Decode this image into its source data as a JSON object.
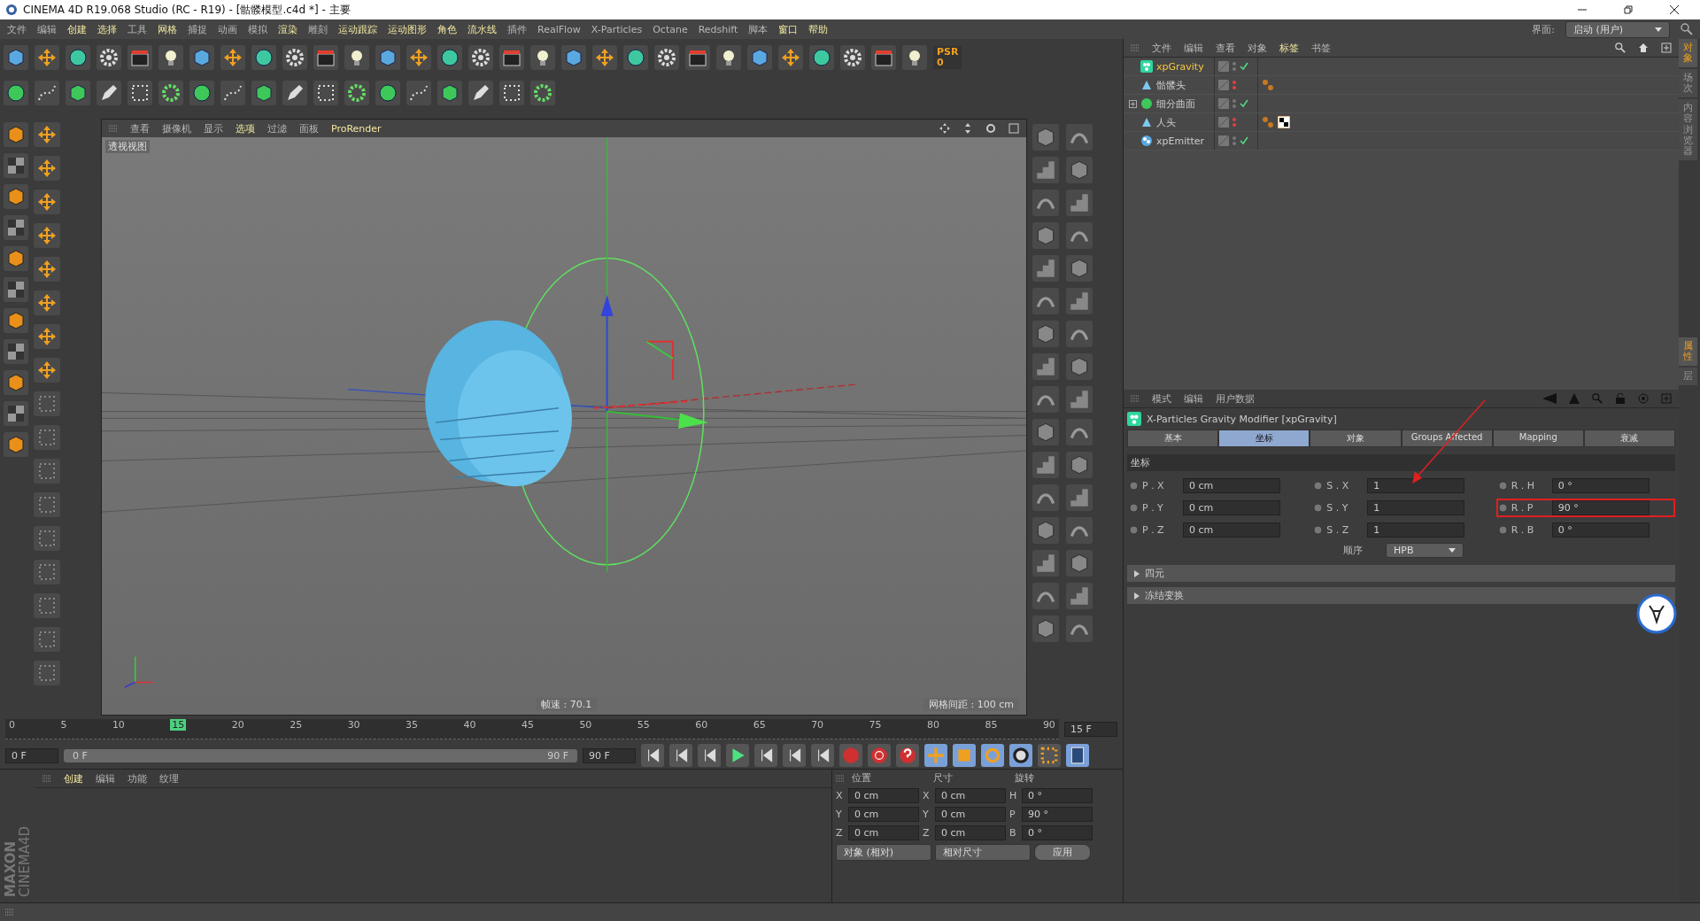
{
  "window": {
    "title": "CINEMA 4D R19.068 Studio (RC - R19) - [骷髅模型.c4d *] - 主要"
  },
  "menu": [
    {
      "label": "文件",
      "highlight": false
    },
    {
      "label": "编辑",
      "highlight": false
    },
    {
      "label": "创建",
      "highlight": true
    },
    {
      "label": "选择",
      "highlight": true
    },
    {
      "label": "工具",
      "highlight": false
    },
    {
      "label": "网格",
      "highlight": true
    },
    {
      "label": "捕捉",
      "highlight": false
    },
    {
      "label": "动画",
      "highlight": false
    },
    {
      "label": "模拟",
      "highlight": false
    },
    {
      "label": "渲染",
      "highlight": true
    },
    {
      "label": "雕刻",
      "highlight": false
    },
    {
      "label": "运动跟踪",
      "highlight": true
    },
    {
      "label": "运动图形",
      "highlight": true
    },
    {
      "label": "角色",
      "highlight": true
    },
    {
      "label": "流水线",
      "highlight": true
    },
    {
      "label": "插件",
      "highlight": false
    },
    {
      "label": "RealFlow",
      "highlight": false
    },
    {
      "label": "X-Particles",
      "highlight": false
    },
    {
      "label": "Octane",
      "highlight": false
    },
    {
      "label": "Redshift",
      "highlight": false
    },
    {
      "label": "脚本",
      "highlight": false
    },
    {
      "label": "窗口",
      "highlight": true
    },
    {
      "label": "帮助",
      "highlight": true
    }
  ],
  "layout_picker": {
    "label": "界面:",
    "value": "启动 (用户)"
  },
  "psr": {
    "label": "PSR",
    "value": "0"
  },
  "viewport": {
    "menu": [
      {
        "label": "查看",
        "highlight": false
      },
      {
        "label": "摄像机",
        "highlight": false
      },
      {
        "label": "显示",
        "highlight": false
      },
      {
        "label": "选项",
        "highlight": true
      },
      {
        "label": "过滤",
        "highlight": false
      },
      {
        "label": "面板",
        "highlight": false
      },
      {
        "label": "ProRender",
        "highlight": true
      }
    ],
    "camera_label": "透视视图",
    "fps": "帧速 : 70.1",
    "grid_spacing": "网格间距 : 100 cm"
  },
  "object_manager": {
    "menu": [
      {
        "label": "文件",
        "highlight": false
      },
      {
        "label": "编辑",
        "highlight": false
      },
      {
        "label": "查看",
        "highlight": false
      },
      {
        "label": "对象",
        "highlight": false
      },
      {
        "label": "标签",
        "highlight": true
      },
      {
        "label": "书签",
        "highlight": false
      }
    ],
    "objects": [
      {
        "name": "xpGravity",
        "kind": "modifier",
        "selected": true,
        "expandable": false,
        "checked": true
      },
      {
        "name": "骷髅头",
        "kind": "polygon",
        "selected": false,
        "expandable": false,
        "checked": false,
        "tags": [
          {
            "kind": "material"
          }
        ]
      },
      {
        "name": "细分曲面",
        "kind": "subdivision",
        "selected": false,
        "expandable": true,
        "checked": true
      },
      {
        "name": "人头",
        "kind": "polygon",
        "selected": false,
        "expandable": false,
        "checked": false,
        "tags": [
          {
            "kind": "material"
          },
          {
            "kind": "texture"
          }
        ]
      },
      {
        "name": "xpEmitter",
        "kind": "emitter",
        "selected": false,
        "expandable": false,
        "checked": true
      }
    ]
  },
  "attributes": {
    "menu": [
      {
        "label": "模式",
        "highlight": false
      },
      {
        "label": "编辑",
        "highlight": false
      },
      {
        "label": "用户数据",
        "highlight": false
      }
    ],
    "title": "X-Particles Gravity Modifier [xpGravity]",
    "tabs": [
      {
        "label": "基本",
        "selected": false
      },
      {
        "label": "坐标",
        "selected": true
      },
      {
        "label": "对象",
        "selected": false
      },
      {
        "label": "Groups Affected",
        "selected": false
      },
      {
        "label": "Mapping",
        "selected": false
      },
      {
        "label": "衰减",
        "selected": false
      }
    ],
    "section": "坐标",
    "rows": [
      [
        {
          "label": "P . X",
          "value": "0 cm",
          "highlighted": false
        },
        {
          "label": "S . X",
          "value": "1",
          "highlighted": false
        },
        {
          "label": "R . H",
          "value": "0 °",
          "highlighted": false
        }
      ],
      [
        {
          "label": "P . Y",
          "value": "0 cm",
          "highlighted": false
        },
        {
          "label": "S . Y",
          "value": "1",
          "highlighted": false
        },
        {
          "label": "R . P",
          "value": "90 °",
          "highlighted": true
        }
      ],
      [
        {
          "label": "P . Z",
          "value": "0 cm",
          "highlighted": false
        },
        {
          "label": "S . Z",
          "value": "1",
          "highlighted": false
        },
        {
          "label": "R . B",
          "value": "0 °",
          "highlighted": false
        }
      ]
    ],
    "order": {
      "label": "顺序",
      "value": "HPB"
    },
    "groups": [
      {
        "label": "四元",
        "expanded": false
      },
      {
        "label": "冻结变换",
        "expanded": false
      }
    ]
  },
  "side_tabs_top": [
    {
      "label": "对象",
      "selected": true
    },
    {
      "label": "场次",
      "selected": false
    },
    {
      "label": "内容浏览器",
      "selected": false
    }
  ],
  "side_tabs_bottom": [
    {
      "label": "属性",
      "selected": true
    },
    {
      "label": "层",
      "selected": false
    }
  ],
  "timeline": {
    "ticks": [
      {
        "label": "0",
        "selected": false
      },
      {
        "label": "5",
        "selected": false
      },
      {
        "label": "10",
        "selected": false
      },
      {
        "label": "15",
        "selected": true
      },
      {
        "label": "20",
        "selected": false
      },
      {
        "label": "25",
        "selected": false
      },
      {
        "label": "30",
        "selected": false
      },
      {
        "label": "35",
        "selected": false
      },
      {
        "label": "40",
        "selected": false
      },
      {
        "label": "45",
        "selected": false
      },
      {
        "label": "50",
        "selected": false
      },
      {
        "label": "55",
        "selected": false
      },
      {
        "label": "60",
        "selected": false
      },
      {
        "label": "65",
        "selected": false
      },
      {
        "label": "70",
        "selected": false
      },
      {
        "label": "75",
        "selected": false
      },
      {
        "label": "80",
        "selected": false
      },
      {
        "label": "85",
        "selected": false
      },
      {
        "label": "90",
        "selected": false
      }
    ],
    "current": "15 F",
    "start": "0 F",
    "range": {
      "start": "0 F",
      "end": "90 F",
      "level": 1
    },
    "end": "90 F"
  },
  "material_manager": {
    "menu": [
      {
        "label": "创建",
        "highlight": true
      },
      {
        "label": "编辑",
        "highlight": false
      },
      {
        "label": "功能",
        "highlight": false
      },
      {
        "label": "纹理",
        "highlight": false
      }
    ]
  },
  "logo": {
    "brand": "MAXON",
    "product": "CINEMA4D"
  },
  "coordinates": {
    "headers": [
      "位置",
      "尺寸",
      "旋转"
    ],
    "rows": [
      {
        "pos_axis": "X",
        "pos": "0 cm",
        "size_axis": "X",
        "size": "0 cm",
        "rot_axis": "H",
        "rot": "0 °"
      },
      {
        "pos_axis": "Y",
        "pos": "0 cm",
        "size_axis": "Y",
        "size": "0 cm",
        "rot_axis": "P",
        "rot": "90 °"
      },
      {
        "pos_axis": "Z",
        "pos": "0 cm",
        "size_axis": "Z",
        "size": "0 cm",
        "rot_axis": "B",
        "rot": "0 °"
      }
    ],
    "mode": "对象 (相对)",
    "size_mode": "相对尺寸",
    "apply": "应用"
  }
}
